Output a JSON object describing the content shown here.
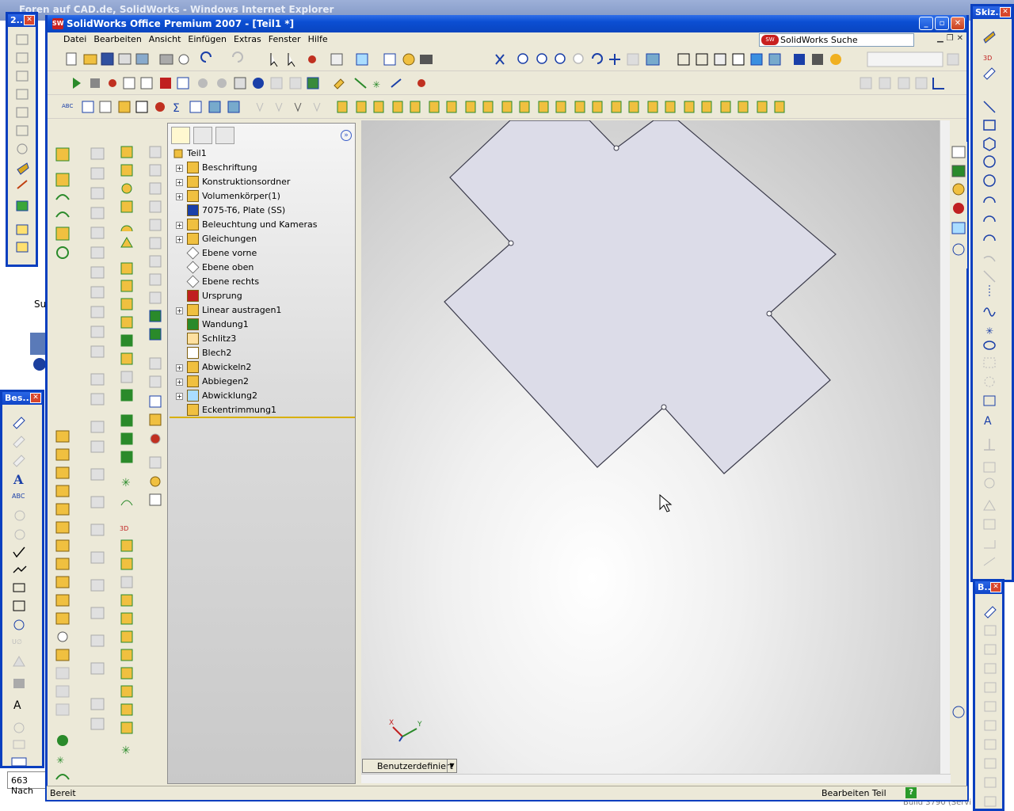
{
  "ie": {
    "title": "Foren auf CAD.de, SolidWorks - Windows Internet Explorer",
    "body_text": "Su",
    "status_text": "663 Nach",
    "build_text": "Build 3790 (Servi"
  },
  "palettes": {
    "p1_title": "2...",
    "p2_title": "Bes...",
    "p3_title": "Skiz...",
    "p4_title": "B..."
  },
  "window": {
    "title": "SolidWorks Office Premium 2007 - [Teil1 *]"
  },
  "menu": [
    "Datei",
    "Bearbeiten",
    "Ansicht",
    "Einfügen",
    "Extras",
    "Fenster",
    "Hilfe"
  ],
  "search": {
    "label": "SolidWorks Suche"
  },
  "feature_manager": {
    "root": "Teil1",
    "items": [
      {
        "label": "Beschriftung",
        "expandable": true,
        "icon": "annotation-icon"
      },
      {
        "label": "Konstruktionsordner",
        "expandable": true,
        "icon": "design-binder-icon"
      },
      {
        "label": "Volumenkörper(1)",
        "expandable": true,
        "icon": "solid-bodies-icon"
      },
      {
        "label": "7075-T6, Plate (SS)",
        "expandable": false,
        "icon": "material-icon"
      },
      {
        "label": "Beleuchtung und Kameras",
        "expandable": true,
        "icon": "lights-icon"
      },
      {
        "label": "Gleichungen",
        "expandable": true,
        "icon": "equations-icon"
      },
      {
        "label": "Ebene vorne",
        "expandable": false,
        "icon": "plane-icon"
      },
      {
        "label": "Ebene oben",
        "expandable": false,
        "icon": "plane-icon"
      },
      {
        "label": "Ebene rechts",
        "expandable": false,
        "icon": "plane-icon"
      },
      {
        "label": "Ursprung",
        "expandable": false,
        "icon": "origin-icon"
      },
      {
        "label": "Linear austragen1",
        "expandable": true,
        "icon": "extrude-icon"
      },
      {
        "label": "Wandung1",
        "expandable": false,
        "icon": "shell-icon"
      },
      {
        "label": "Schlitz3",
        "expandable": false,
        "icon": "rip-icon"
      },
      {
        "label": "Blech2",
        "expandable": false,
        "icon": "sheet-metal-icon"
      },
      {
        "label": "Abwickeln2",
        "expandable": true,
        "icon": "unfold-icon"
      },
      {
        "label": "Abbiegen2",
        "expandable": true,
        "icon": "fold-icon"
      },
      {
        "label": "Abwicklung2",
        "expandable": true,
        "icon": "flat-pattern-icon"
      },
      {
        "label": "Eckentrimmung1",
        "expandable": false,
        "icon": "corner-trim-icon"
      }
    ]
  },
  "view": {
    "orientation": "Benutzerdefiniert"
  },
  "triad": {
    "x": "X",
    "y": "Y"
  },
  "status": {
    "left": "Bereit",
    "right": "Bearbeiten Teil",
    "help": "?"
  },
  "colors": {
    "titlebar": "#0a45c0",
    "part_face": "#dcdce8",
    "accent": "#0a3fbf"
  }
}
